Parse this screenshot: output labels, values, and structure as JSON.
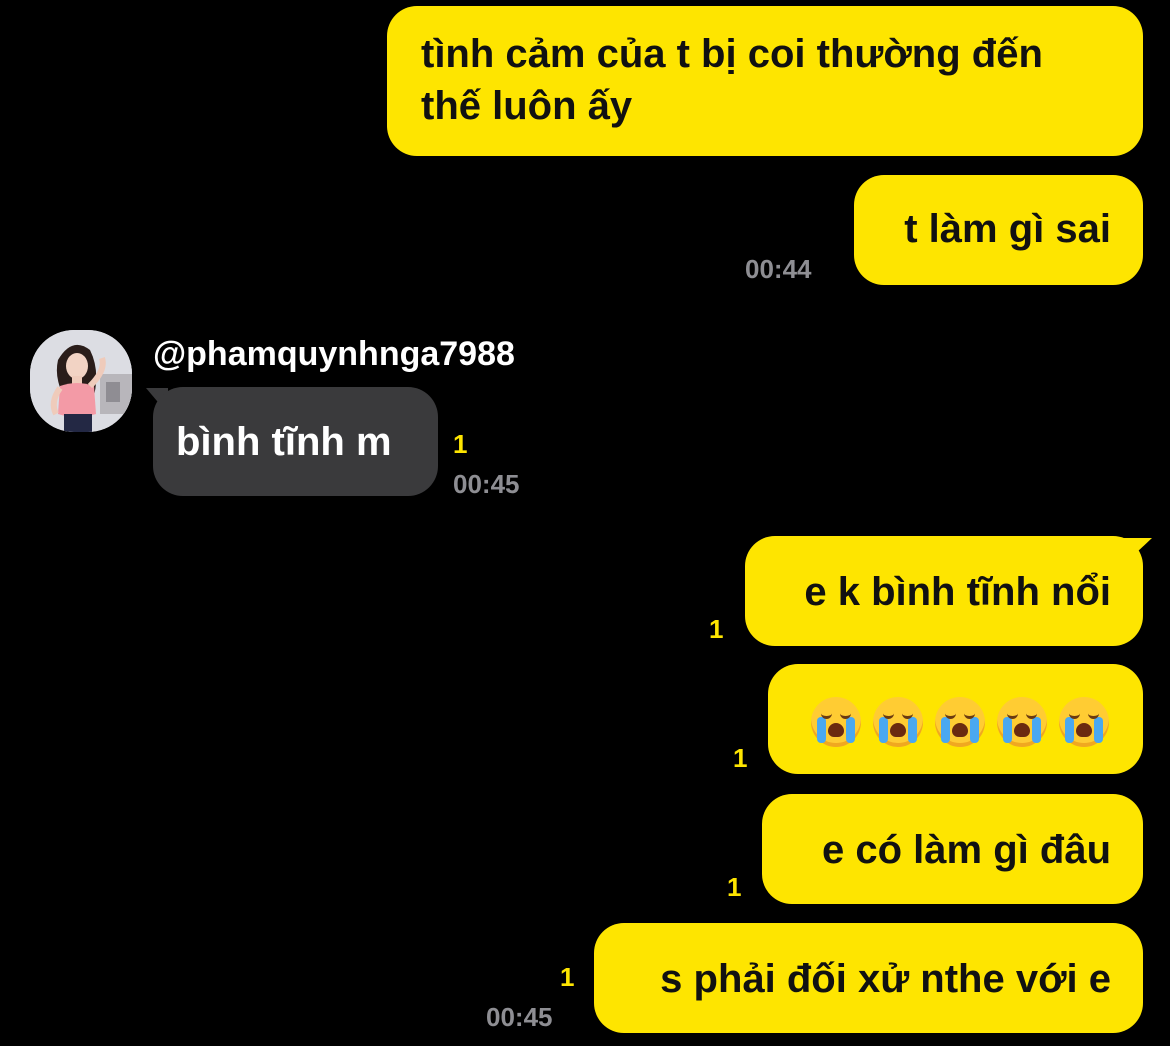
{
  "messages": {
    "m1": {
      "line1": "tình cảm của t bị coi thường đến",
      "line2": "thế luôn ấy"
    },
    "m2": {
      "text": "t làm gì sai",
      "time": "00:44"
    },
    "m3": {
      "sender": "@phamquynhnga7988",
      "text": "bình tĩnh m",
      "unread": "1",
      "time": "00:45"
    },
    "m4": {
      "text": "e k bình tĩnh nổi",
      "unread": "1"
    },
    "m5": {
      "emojis": [
        "loudly-crying-face",
        "loudly-crying-face",
        "loudly-crying-face",
        "loudly-crying-face",
        "loudly-crying-face"
      ],
      "unread": "1"
    },
    "m6": {
      "text": "e có làm gì đâu",
      "unread": "1"
    },
    "m7": {
      "text": "s phải đối xử nthe với e",
      "unread": "1",
      "time": "00:45"
    }
  },
  "colors": {
    "background": "#000000",
    "my_bubble": "#fee500",
    "their_bubble": "#3a3a3c",
    "unread": "#fee500",
    "time": "#8e8e93"
  }
}
